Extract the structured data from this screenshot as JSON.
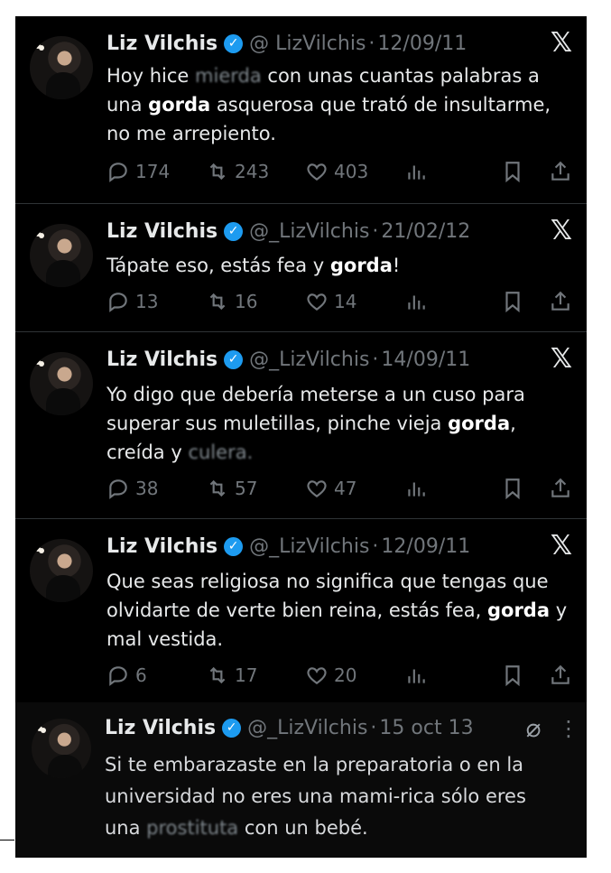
{
  "tweets": [
    {
      "name": "Liz Vilchis",
      "handle": "@ LizVilchis",
      "date": "12/09/11",
      "text_before_blur": "Hoy hice ",
      "blurred": "mierda",
      "text_a": " con unas cuantas palabras a una ",
      "bold": "gorda",
      "text_b": " asquerosa que trató de insultarme, no me arrepiento.",
      "replies": "174",
      "retweets": "243",
      "likes": "403"
    },
    {
      "name": "Liz Vilchis",
      "handle": "@_LizVilchis",
      "date": "21/02/12",
      "text_a": "Tápate eso, estás fea y ",
      "bold": "gorda",
      "text_b": "!",
      "replies": "13",
      "retweets": "16",
      "likes": "14"
    },
    {
      "name": "Liz Vilchis",
      "handle": "@_LizVilchis",
      "date": "14/09/11",
      "text_a": "Yo digo que debería meterse a un cuso para superar sus muletillas, pinche vieja ",
      "bold": "gorda",
      "text_b": ", creída y ",
      "blurred": "culera.",
      "replies": "38",
      "retweets": "57",
      "likes": "47"
    },
    {
      "name": "Liz Vilchis",
      "handle": "@_LizVilchis",
      "date": "12/09/11",
      "text_a": "Que seas religiosa no significa que tengas que olvidarte de verte bien reina, estás fea, ",
      "bold": "gorda",
      "text_b": " y mal vestida.",
      "replies": "6",
      "retweets": "17",
      "likes": "20"
    },
    {
      "name": "Liz Vilchis",
      "handle": "@_LizVilchis",
      "date": "15 oct 13",
      "text_a": "Si te embarazaste en la preparatoria o en la universidad no eres una mami-rica sólo eres una ",
      "blurred": "prostituta",
      "text_b": " con un bebé."
    }
  ],
  "icons": {
    "x_logo": "𝕏",
    "verified": "✓",
    "more": "⋮"
  },
  "colors": {
    "background": "#000000",
    "verified": "#1d9bf0",
    "muted": "#71767b",
    "text": "#e7e9ea"
  }
}
